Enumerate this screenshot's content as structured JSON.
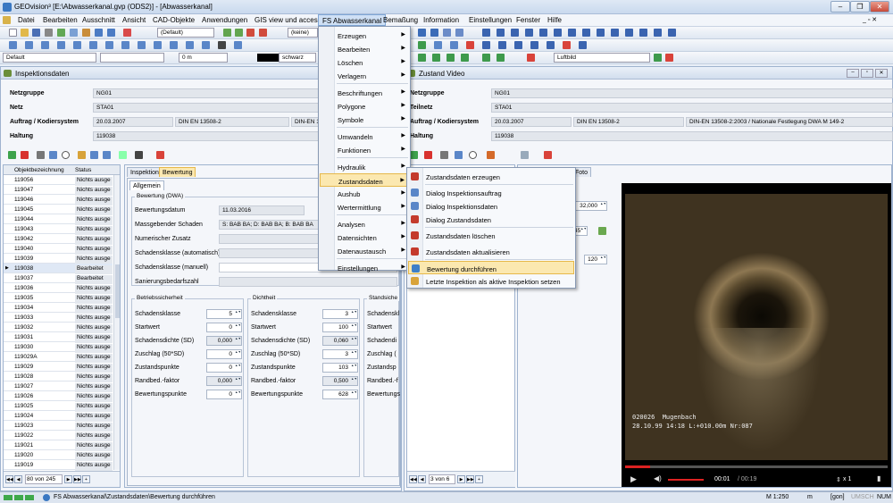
{
  "window": {
    "title": "GEOvision³ [E:\\Abwasserkanal.gvp (ODS2)] - [Abwasserkanal]"
  },
  "menubar": {
    "items": [
      "Datei",
      "Bearbeiten",
      "Ausschnitt",
      "Ansicht",
      "CAD-Objekte",
      "Anwendungen",
      "GIS view und access",
      "FS Abwasserkanal",
      "Bemaßung",
      "Information",
      "Einstellungen",
      "Fenster",
      "Hilfe"
    ]
  },
  "toolbar": {
    "style_value": "(Default)",
    "keine_value": "(keine)",
    "layer_value": "Default",
    "dist_value": "0 m",
    "color_value": "schwarz",
    "image_value": "Luftbild"
  },
  "insp": {
    "title": "Inspektionsdaten",
    "netzgruppe_label": "Netzgruppe",
    "netzgruppe": "NG01",
    "netz_label": "Netz",
    "netz": "STA01",
    "auftrag_label": "Auftrag / Kodiersystem",
    "auftrag_date": "20.03.2007",
    "auftrag_norm": "DIN EN 13508-2",
    "auftrag_norm2": "DIN-EN 13",
    "haltung_label": "Haltung",
    "haltung": "119038",
    "list_headers": [
      "Objektbezeichnung",
      "Status"
    ],
    "rows": [
      {
        "id": "119056",
        "status": "Nichts ausge"
      },
      {
        "id": "119047",
        "status": "Nichts ausge"
      },
      {
        "id": "119046",
        "status": "Nichts ausge"
      },
      {
        "id": "119045",
        "status": "Nichts ausge"
      },
      {
        "id": "119044",
        "status": "Nichts ausge"
      },
      {
        "id": "119043",
        "status": "Nichts ausge"
      },
      {
        "id": "119042",
        "status": "Nichts ausge"
      },
      {
        "id": "119040",
        "status": "Nichts ausge"
      },
      {
        "id": "119039",
        "status": "Nichts ausge"
      },
      {
        "id": "119038",
        "status": "Bearbeitet"
      },
      {
        "id": "119037",
        "status": "Bearbeitet"
      },
      {
        "id": "119036",
        "status": "Nichts ausge"
      },
      {
        "id": "119035",
        "status": "Nichts ausge"
      },
      {
        "id": "119034",
        "status": "Nichts ausge"
      },
      {
        "id": "119033",
        "status": "Nichts ausge"
      },
      {
        "id": "119032",
        "status": "Nichts ausge"
      },
      {
        "id": "119031",
        "status": "Nichts ausge"
      },
      {
        "id": "119030",
        "status": "Nichts ausge"
      },
      {
        "id": "119029A",
        "status": "Nichts ausge"
      },
      {
        "id": "119029",
        "status": "Nichts ausge"
      },
      {
        "id": "119028",
        "status": "Nichts ausge"
      },
      {
        "id": "119027",
        "status": "Nichts ausge"
      },
      {
        "id": "119026",
        "status": "Nichts ausge"
      },
      {
        "id": "119025",
        "status": "Nichts ausge"
      },
      {
        "id": "119024",
        "status": "Nichts ausge"
      },
      {
        "id": "119023",
        "status": "Nichts ausge"
      },
      {
        "id": "119022",
        "status": "Nichts ausge"
      },
      {
        "id": "119021",
        "status": "Nichts ausge"
      },
      {
        "id": "119020",
        "status": "Nichts ausge"
      },
      {
        "id": "119019",
        "status": "Nichts ausge"
      }
    ],
    "nav_text": "80 von 245",
    "tabs": [
      "Inspektion",
      "Bewertung"
    ],
    "subtab": "Allgemein",
    "bew_group": "Bewertung (DWA)",
    "datum_label": "Bewertungsdatum",
    "datum": "11.03.2016",
    "schaden_label": "Massgebender Schaden",
    "schaden": "S: BAB BA; D: BAB BA; B: BAB BA",
    "zusatz_label": "Numerischer Zusatz",
    "klasse_auto_label": "Schadensklasse (automatisch)",
    "klasse_man_label": "Schadensklasse (manuell)",
    "sanierung_label": "Sanierungsbedarfszahl",
    "g1": {
      "title": "Betriebssicherheit",
      "rows": [
        [
          "Schadensklasse",
          "5"
        ],
        [
          "Startwert",
          "0"
        ],
        [
          "Schadensdichte (SD)",
          "0,000"
        ],
        [
          "Zuschlag (50*SD)",
          "0"
        ],
        [
          "Zustandspunkte",
          "0"
        ],
        [
          "Randbed.-faktor",
          "0,000"
        ],
        [
          "Bewertungspunkte",
          "0"
        ]
      ]
    },
    "g2": {
      "title": "Dichtheit",
      "rows": [
        [
          "Schadensklasse",
          "3"
        ],
        [
          "Startwert",
          "100"
        ],
        [
          "Schadensdichte (SD)",
          "0,060"
        ],
        [
          "Zuschlag (50*SD)",
          "3"
        ],
        [
          "Zustandspunkte",
          "103"
        ],
        [
          "Randbed.-faktor",
          "0,500"
        ],
        [
          "Bewertungspunkte",
          "628"
        ]
      ]
    },
    "g3": {
      "title": "Standsiche",
      "rows": [
        "Schadenskl",
        "Startwert",
        "Schadendi",
        "Zuschlag (",
        "Zustandsp",
        "Randbed.-f",
        "Bewertungs"
      ]
    }
  },
  "video": {
    "title": "Zustand Video",
    "netzgruppe": "NG01",
    "netz_label": "Teilnetz",
    "netz": "STA01",
    "auftrag_date": "20.03.2007",
    "auftrag_norm": "DIN EN 13508-2",
    "auftrag_norm2": "DIN-EN 13508-2:2003 / Nationale Festlegung DWA M 149-2",
    "haltung": "119038",
    "photo_tab": "Foto",
    "val1": "32,000",
    "val2": "45",
    "val3": "120",
    "nav_text": "3 von 6",
    "overlay1": "020026  Mugenbach",
    "overlay2": "28.10.99 14:18 L:+010.00m Nr:087",
    "time": "00:01",
    "duration": "/ 00:19",
    "speed": "x 1"
  },
  "menu_main": [
    "Erzeugen",
    "Bearbeiten",
    "Löschen",
    "Verlagern",
    "Beschriftungen",
    "Polygone",
    "Symbole",
    "Umwandeln",
    "Funktionen",
    "Hydraulik",
    "Zustandsdaten",
    "Aushub",
    "Wertermittlung",
    "Analysen",
    "Datensichten",
    "Datenaustausch",
    "Einstellungen"
  ],
  "menu_sub": [
    "Zustandsdaten erzeugen",
    "Dialog Inspektionsauftrag",
    "Dialog Inspektionsdaten",
    "Dialog Zustandsdaten",
    "Zustandsdaten löschen",
    "Zustandsdaten aktualisieren",
    "Bewertung durchführen",
    "Letzte Inspektion als aktive Inspektion setzen"
  ],
  "status": {
    "path": "FS Abwasserkanal\\Zustandsdaten\\Bewertung durchführen",
    "scale": "M 1:250",
    "unit": "m",
    "gon": "[gon]",
    "umsch": "UMSCH",
    "num": "NUM"
  }
}
